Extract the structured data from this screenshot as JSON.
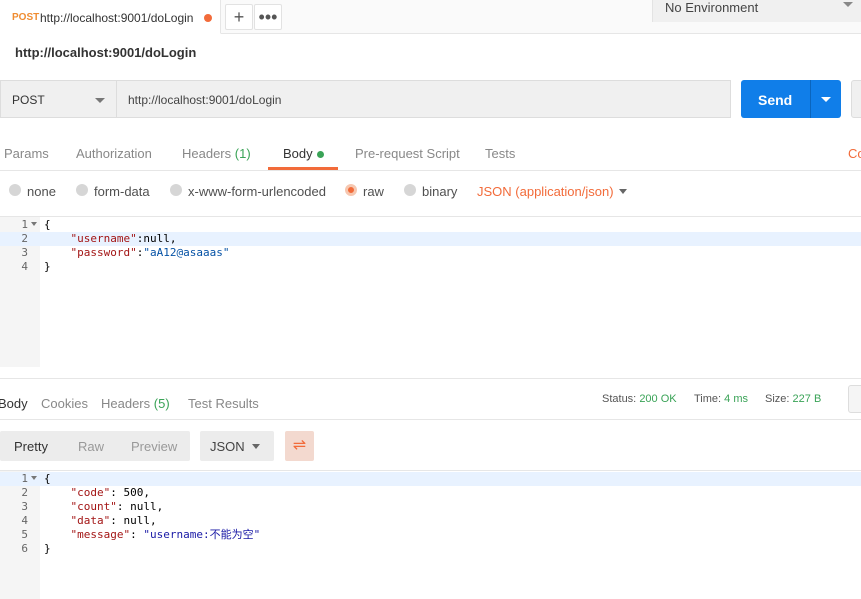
{
  "tab": {
    "method": "POST",
    "url": "http://localhost:9001/doLogin"
  },
  "environment": {
    "selected": "No Environment"
  },
  "request": {
    "name": "http://localhost:9001/doLogin",
    "method": "POST",
    "url": "http://localhost:9001/doLogin",
    "send_label": "Send"
  },
  "request_tabs": {
    "params": "Params",
    "authorization": "Authorization",
    "headers": "Headers",
    "headers_count": "(1)",
    "body": "Body",
    "pre_request": "Pre-request Script",
    "tests": "Tests",
    "cookies_partial": "Co"
  },
  "body_types": {
    "none": "none",
    "form_data": "form-data",
    "urlencoded": "x-www-form-urlencoded",
    "raw": "raw",
    "binary": "binary",
    "content_type": "JSON (application/json)"
  },
  "request_body": {
    "line_numbers": [
      "1",
      "2",
      "3",
      "4"
    ],
    "lines": [
      {
        "t": "{"
      },
      {
        "key": "\"username\"",
        "rest": ":null,"
      },
      {
        "key": "\"password\"",
        "sep": ":",
        "str": "\"aA12@asaaas\""
      },
      {
        "t": "}"
      }
    ]
  },
  "response_tabs": {
    "body": "Body",
    "cookies": "Cookies",
    "headers": "Headers",
    "headers_count": "(5)",
    "test_results": "Test Results"
  },
  "response_status": {
    "status_label": "Status:",
    "status_value": "200 OK",
    "time_label": "Time:",
    "time_value": "4 ms",
    "size_label": "Size:",
    "size_value": "227 B"
  },
  "view_modes": {
    "pretty": "Pretty",
    "raw": "Raw",
    "preview": "Preview",
    "format": "JSON"
  },
  "response_body": {
    "line_numbers": [
      "1",
      "2",
      "3",
      "4",
      "5",
      "6"
    ],
    "lines": [
      {
        "t": "{"
      },
      {
        "key": "\"code\"",
        "rest": ": 500,"
      },
      {
        "key": "\"count\"",
        "rest": ": null,"
      },
      {
        "key": "\"data\"",
        "rest": ": null,"
      },
      {
        "key": "\"message\"",
        "sep": ": ",
        "str": "\"username:不能为空\""
      },
      {
        "t": "}"
      }
    ]
  }
}
